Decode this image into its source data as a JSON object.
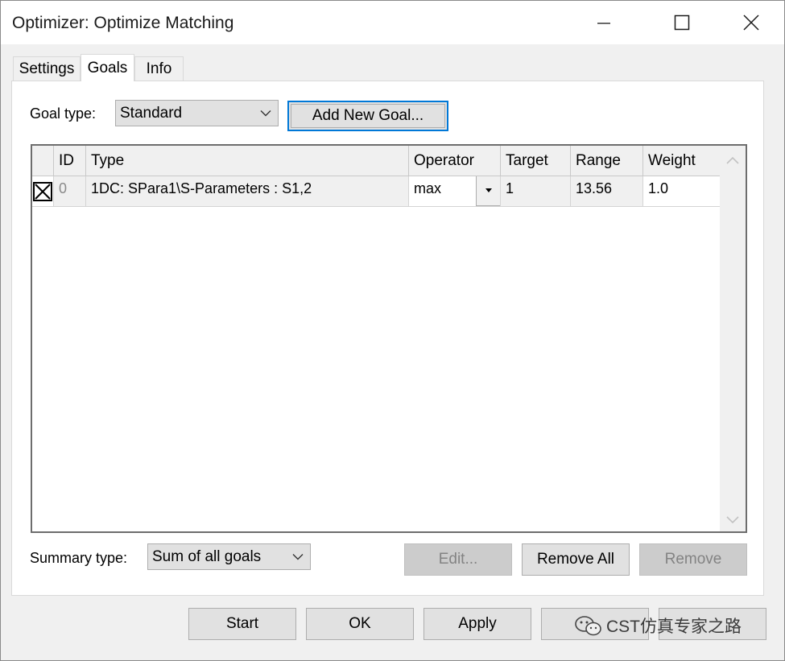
{
  "window": {
    "title": "Optimizer: Optimize Matching"
  },
  "tabs": [
    {
      "label": "Settings",
      "active": false
    },
    {
      "label": "Goals",
      "active": true
    },
    {
      "label": "Info",
      "active": false
    }
  ],
  "goal_type": {
    "label": "Goal type:",
    "value": "Standard"
  },
  "add_goal_label": "Add New Goal...",
  "table": {
    "columns": [
      "ID",
      "Type",
      "Operator",
      "Target",
      "Range",
      "Weight"
    ],
    "rows": [
      {
        "checked": true,
        "id": "0",
        "type": "1DC: SPara1\\S-Parameters : S1,2",
        "operator": "max",
        "target": "1",
        "range": "13.56",
        "weight": "1.0"
      }
    ]
  },
  "summary_type": {
    "label": "Summary type:",
    "value": "Sum of all goals"
  },
  "buttons": {
    "edit": "Edit...",
    "remove_all": "Remove All",
    "remove": "Remove",
    "start": "Start",
    "ok": "OK",
    "apply": "Apply"
  },
  "watermark": "CST仿真专家之路"
}
